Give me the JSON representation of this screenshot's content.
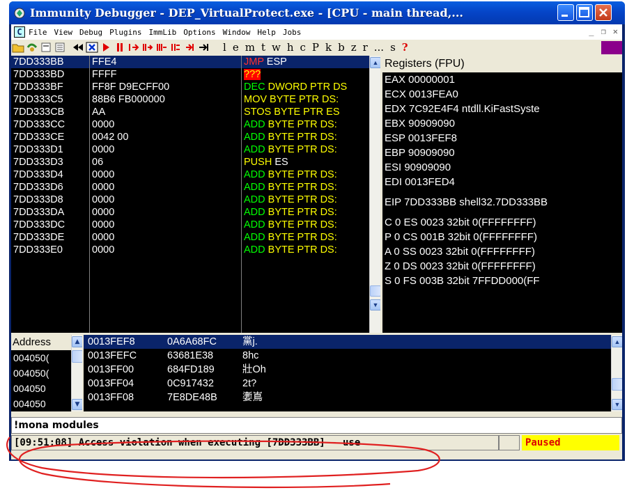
{
  "window": {
    "title": "Immunity Debugger - DEP_VirtualProtect.exe - [CPU - main thread,..."
  },
  "menu": {
    "items": [
      "File",
      "View",
      "Debug",
      "Plugins",
      "ImmLib",
      "Options",
      "Window",
      "Help",
      "Jobs"
    ]
  },
  "toolbar": {
    "letters": [
      "l",
      "e",
      "m",
      "t",
      "w",
      "h",
      "c",
      "P",
      "k",
      "b",
      "z",
      "r",
      "...",
      "s",
      "?"
    ]
  },
  "cpu": {
    "rows": [
      {
        "addr": "7DD333BB",
        "hex": "FFE4",
        "op": "JMP",
        "args": " ESP",
        "selected": true
      },
      {
        "addr": "7DD333BD",
        "hex": "FFFF",
        "op": "???",
        "args": ""
      },
      {
        "addr": "7DD333BF",
        "hex": "FF8F D9ECFF00",
        "op": "DEC",
        "args": " DWORD PTR DS"
      },
      {
        "addr": "7DD333C5",
        "hex": "88B6 FB000000",
        "op": "MOV",
        "args": " BYTE PTR DS:"
      },
      {
        "addr": "7DD333CB",
        "hex": "AA",
        "op": "STOS",
        "args": " BYTE PTR ES"
      },
      {
        "addr": "7DD333CC",
        "hex": "0000",
        "op": "ADD",
        "args": " BYTE PTR DS:"
      },
      {
        "addr": "7DD333CE",
        "hex": "0042 00",
        "op": "ADD",
        "args": " BYTE PTR DS:"
      },
      {
        "addr": "7DD333D1",
        "hex": "0000",
        "op": "ADD",
        "args": " BYTE PTR DS:"
      },
      {
        "addr": "7DD333D3",
        "hex": "06",
        "op": "PUSH",
        "args": " ES"
      },
      {
        "addr": "7DD333D4",
        "hex": "0000",
        "op": "ADD",
        "args": " BYTE PTR DS:"
      },
      {
        "addr": "7DD333D6",
        "hex": "0000",
        "op": "ADD",
        "args": " BYTE PTR DS:"
      },
      {
        "addr": "7DD333D8",
        "hex": "0000",
        "op": "ADD",
        "args": " BYTE PTR DS:"
      },
      {
        "addr": "7DD333DA",
        "hex": "0000",
        "op": "ADD",
        "args": " BYTE PTR DS:"
      },
      {
        "addr": "7DD333DC",
        "hex": "0000",
        "op": "ADD",
        "args": " BYTE PTR DS:"
      },
      {
        "addr": "7DD333DE",
        "hex": "0000",
        "op": "ADD",
        "args": " BYTE PTR DS:"
      },
      {
        "addr": "7DD333E0",
        "hex": "0000",
        "op": "ADD",
        "args": " BYTE PTR DS:"
      }
    ]
  },
  "registers": {
    "header": "Registers (FPU)",
    "lines": [
      "EAX 00000001",
      "ECX 0013FEA0",
      "EDX 7C92E4F4 ntdll.KiFastSyste",
      "EBX 90909090",
      "ESP 0013FEF8",
      "EBP 90909090",
      "ESI 90909090",
      "EDI 0013FED4",
      "",
      "EIP 7DD333BB shell32.7DD333BB",
      "",
      "C 0   ES 0023 32bit 0(FFFFFFFF)",
      "P 0   CS 001B 32bit 0(FFFFFFFF)",
      "A 0   SS 0023 32bit 0(FFFFFFFF)",
      "Z 0   DS 0023 32bit 0(FFFFFFFF)",
      "S 0   FS 003B 32bit 7FFDD000(FF"
    ]
  },
  "dump": {
    "header": "Address",
    "rows": [
      "004050(",
      "004050(",
      "004050",
      "004050"
    ]
  },
  "stack": {
    "rows": [
      {
        "addr": "0013FEF8",
        "val": "0A6A68FC",
        "comment": "黨j.",
        "selected": true
      },
      {
        "addr": "0013FEFC",
        "val": "63681E38",
        "comment": "8hc"
      },
      {
        "addr": "0013FF00",
        "val": "684FD189",
        "comment": "壯Oh"
      },
      {
        "addr": "0013FF04",
        "val": "0C917432",
        "comment": "2t?"
      },
      {
        "addr": "0013FF08",
        "val": "7E8DE48B",
        "comment": "嬱嶌"
      }
    ]
  },
  "command": {
    "value": "!mona modules"
  },
  "status": {
    "message": "[09:51:08] Access violation when executing [7DD333BB] - use",
    "state": "Paused"
  },
  "colors": {
    "opcode_jmp": "#ff3030",
    "opcode_arith": "#00ff00",
    "opcode_mov": "#ffff00",
    "selection": "#0a246a",
    "annotation": "#e02020"
  }
}
